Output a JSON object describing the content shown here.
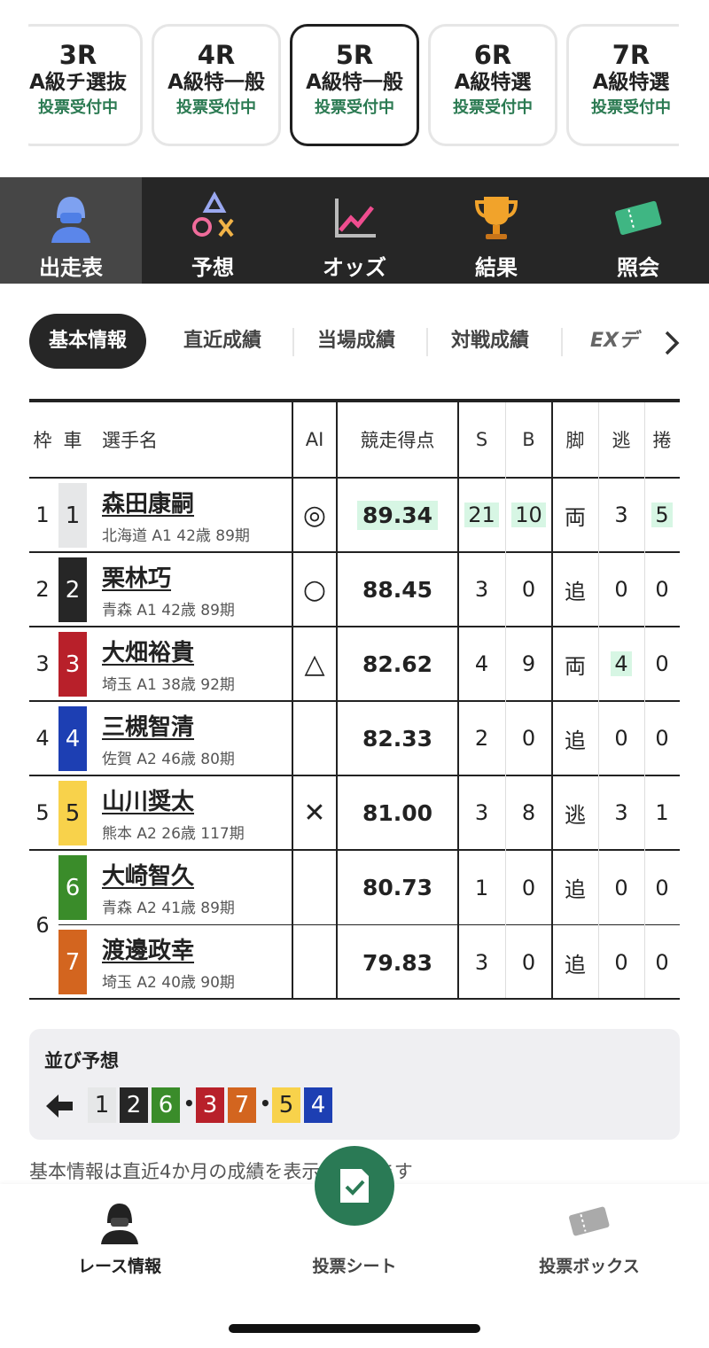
{
  "races": [
    {
      "r": "3R",
      "cls": "A級チ選抜",
      "status": "投票受付中"
    },
    {
      "r": "4R",
      "cls": "A級特一般",
      "status": "投票受付中"
    },
    {
      "r": "5R",
      "cls": "A級特一般",
      "status": "投票受付中"
    },
    {
      "r": "6R",
      "cls": "A級特選",
      "status": "投票受付中"
    },
    {
      "r": "7R",
      "cls": "A級特選",
      "status": "投票受付中"
    }
  ],
  "nav": [
    "出走表",
    "予想",
    "オッズ",
    "結果",
    "照会"
  ],
  "subtabs": [
    "基本情報",
    "直近成績",
    "当場成績",
    "対戦成績",
    "EXデ"
  ],
  "headers": {
    "waku": "枠",
    "sha": "車",
    "name": "選手名",
    "ai": "AI",
    "score": "競走得点",
    "s": "S",
    "b": "B",
    "kyaku": "脚",
    "nige": "逃",
    "makuri": "捲"
  },
  "riders": [
    {
      "waku": "1",
      "no": "1",
      "name": "森田康嗣",
      "meta": "北海道 A1 42歳 89期",
      "ai": "◎",
      "score": "89.34",
      "s": "21",
      "b": "10",
      "kyaku": "両",
      "nige": "3",
      "makuri": "5"
    },
    {
      "waku": "2",
      "no": "2",
      "name": "栗林巧",
      "meta": "青森 A1 42歳 89期",
      "ai": "○",
      "score": "88.45",
      "s": "3",
      "b": "0",
      "kyaku": "追",
      "nige": "0",
      "makuri": "0"
    },
    {
      "waku": "3",
      "no": "3",
      "name": "大畑裕貴",
      "meta": "埼玉 A1 38歳 92期",
      "ai": "△",
      "score": "82.62",
      "s": "4",
      "b": "9",
      "kyaku": "両",
      "nige": "4",
      "makuri": "0"
    },
    {
      "waku": "4",
      "no": "4",
      "name": "三槻智清",
      "meta": "佐賀 A2 46歳 80期",
      "ai": "",
      "score": "82.33",
      "s": "2",
      "b": "0",
      "kyaku": "追",
      "nige": "0",
      "makuri": "0"
    },
    {
      "waku": "5",
      "no": "5",
      "name": "山川奨太",
      "meta": "熊本 A2 26歳 117期",
      "ai": "✕",
      "score": "81.00",
      "s": "3",
      "b": "8",
      "kyaku": "逃",
      "nige": "3",
      "makuri": "1"
    },
    {
      "waku": "",
      "no": "6",
      "name": "大崎智久",
      "meta": "青森 A2 41歳 89期",
      "ai": "",
      "score": "80.73",
      "s": "1",
      "b": "0",
      "kyaku": "追",
      "nige": "0",
      "makuri": "0"
    },
    {
      "waku": "",
      "no": "7",
      "name": "渡邊政幸",
      "meta": "埼玉 A2 40歳 90期",
      "ai": "",
      "score": "79.83",
      "s": "3",
      "b": "0",
      "kyaku": "追",
      "nige": "0",
      "makuri": "0"
    }
  ],
  "waku6": "6",
  "narabi": {
    "title": "並び予想",
    "seq": [
      "1",
      "2",
      "6",
      "3",
      "7",
      "5",
      "4"
    ]
  },
  "note": "基本情報は直近4か月の成績を表示しています",
  "bottom": [
    "レース情報",
    "投票シート",
    "投票ボックス"
  ],
  "colors": {
    "c1": "#e6e7e8",
    "c2": "#262626",
    "c3": "#b8202a",
    "c4": "#1d3fb3",
    "c5": "#f8d24b",
    "c6": "#3a8c2a",
    "c7": "#d3651f",
    "accent": "#2a7a55"
  }
}
